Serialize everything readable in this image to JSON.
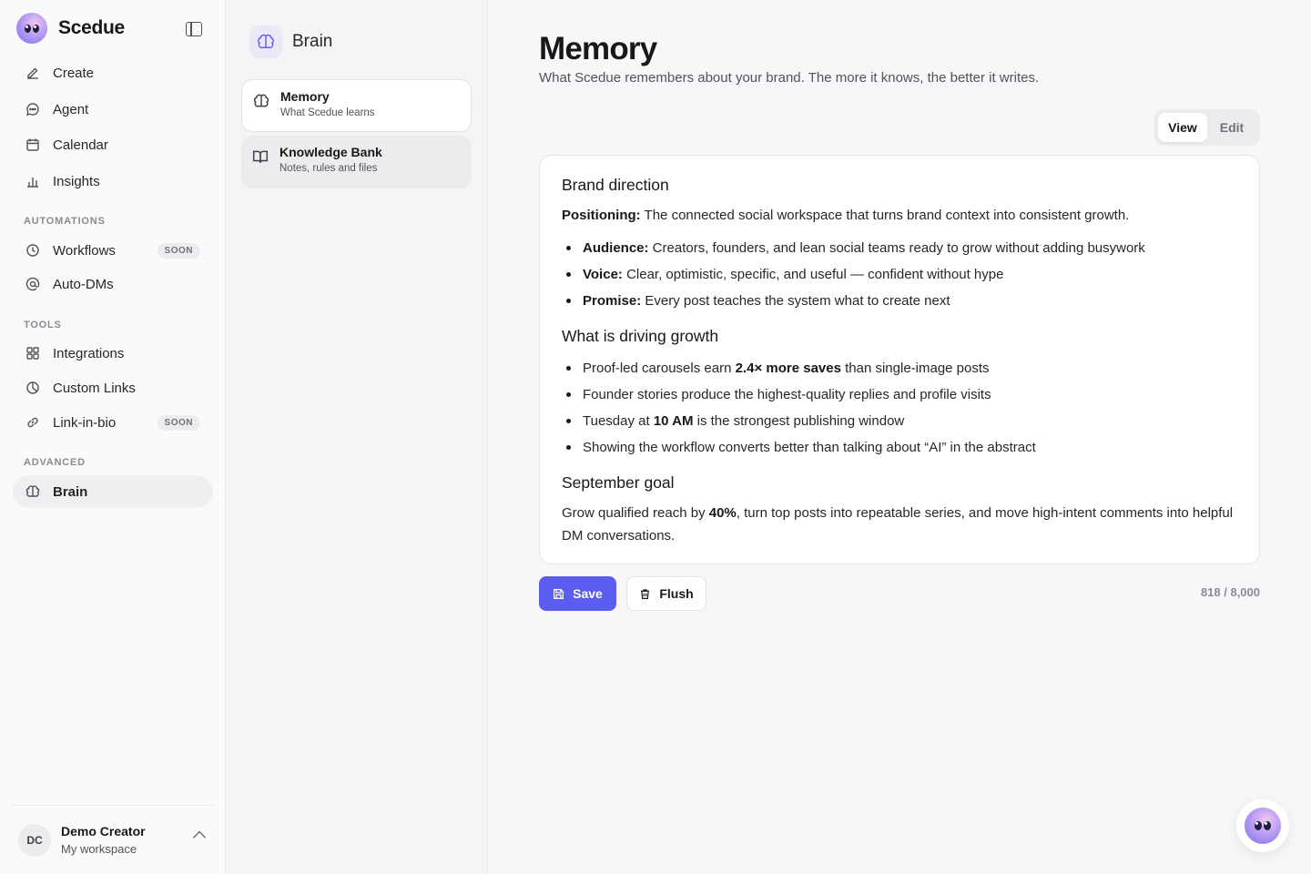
{
  "app": {
    "name": "Scedue"
  },
  "sidebar": {
    "nav": [
      {
        "label": "Create",
        "icon": "edit-icon"
      },
      {
        "label": "Agent",
        "icon": "chat-icon"
      },
      {
        "label": "Calendar",
        "icon": "calendar-icon"
      },
      {
        "label": "Insights",
        "icon": "bar-chart-icon"
      }
    ],
    "automations_label": "AUTOMATIONS",
    "automations": [
      {
        "label": "Workflows",
        "badge": "SOON"
      },
      {
        "label": "Auto-DMs"
      }
    ],
    "tools_label": "TOOLS",
    "tools": [
      {
        "label": "Integrations"
      },
      {
        "label": "Custom Links"
      },
      {
        "label": "Link-in-bio",
        "badge": "SOON"
      }
    ],
    "advanced_label": "ADVANCED",
    "advanced": [
      {
        "label": "Brain",
        "active": true
      }
    ],
    "user": {
      "initials": "DC",
      "name": "Demo Creator",
      "workspace": "My workspace"
    }
  },
  "brain_panel": {
    "title": "Brain",
    "cards": [
      {
        "title": "Memory",
        "subtitle": "What Scedue learns",
        "active": true
      },
      {
        "title": "Knowledge Bank",
        "subtitle": "Notes, rules and files",
        "active": false
      }
    ]
  },
  "main": {
    "title": "Memory",
    "subtitle": "What Scedue remembers about your brand. The more it knows, the better it writes.",
    "toggle": {
      "view": "View",
      "edit": "Edit",
      "selected": "View"
    },
    "doc": {
      "s1_heading": "Brand direction",
      "positioning_label": "Positioning:",
      "positioning_text": " The connected social workspace that turns brand context into consistent growth.",
      "audience_label": "Audience:",
      "audience_text": " Creators, founders, and lean social teams ready to grow without adding busywork",
      "voice_label": "Voice:",
      "voice_text": " Clear, optimistic, specific, and useful — confident without hype",
      "promise_label": "Promise:",
      "promise_text": " Every post teaches the system what to create next",
      "s2_heading": "What is driving growth",
      "g1_pre": "Proof-led carousels earn ",
      "g1_bold": "2.4× more saves",
      "g1_post": " than single-image posts",
      "g2": "Founder stories produce the highest-quality replies and profile visits",
      "g3_pre": "Tuesday at ",
      "g3_bold": "10 AM",
      "g3_post": " is the strongest publishing window",
      "g4": "Showing the workflow converts better than talking about “AI” in the abstract",
      "s3_heading": "September goal",
      "goal_pre": "Grow qualified reach by ",
      "goal_bold": "40%",
      "goal_post": ", turn top posts into repeatable series, and move high-intent comments into helpful DM conversations."
    },
    "save_label": "Save",
    "flush_label": "Flush",
    "counter": "818 / 8,000"
  },
  "colors": {
    "accent": "#5b5cf0"
  }
}
